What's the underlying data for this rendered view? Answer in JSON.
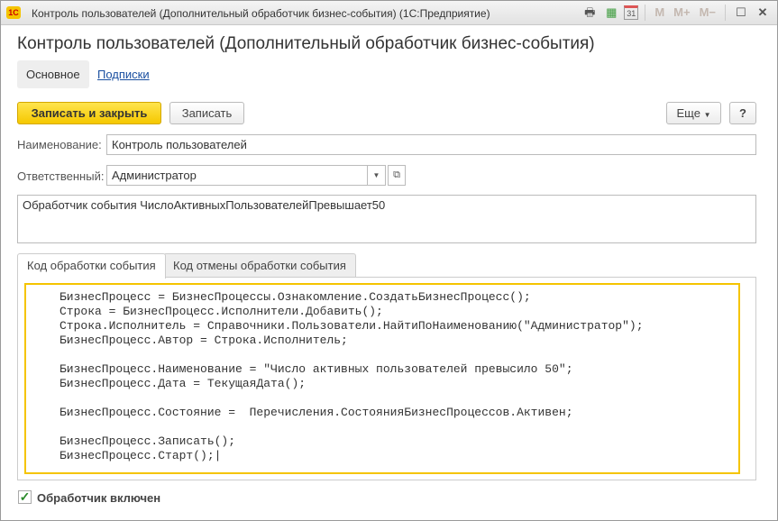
{
  "window": {
    "title": "Контроль пользователей (Дополнительный обработчик бизнес-события)  (1С:Предприятие)",
    "logo": "1С",
    "icons": [
      "print-icon",
      "calculator-icon",
      "calendar-icon"
    ],
    "calendar_day": "31",
    "mem": [
      "M",
      "M+",
      "M−"
    ]
  },
  "header": {
    "title": "Контроль пользователей (Дополнительный обработчик бизнес-события)"
  },
  "tabs_top": [
    {
      "label": "Основное"
    },
    {
      "label": "Подписки"
    }
  ],
  "toolbar": {
    "save_close": "Записать и закрыть",
    "save": "Записать",
    "more": "Еще",
    "help": "?"
  },
  "form": {
    "name_label": "Наименование:",
    "name_value": "Контроль пользователей",
    "resp_label": "Ответственный:",
    "resp_value": "Администратор",
    "description": "Обработчик события ЧислоАктивныхПользователейПревышает50"
  },
  "code_tabs": [
    {
      "label": "Код обработки события"
    },
    {
      "label": "Код отмены обработки события"
    }
  ],
  "code": "БизнесПроцесс = БизнесПроцессы.Ознакомление.СоздатьБизнесПроцесс();\nСтрока = БизнесПроцесс.Исполнители.Добавить();\nСтрока.Исполнитель = Справочники.Пользователи.НайтиПоНаименованию(\"Администратор\");\nБизнесПроцесс.Автор = Строка.Исполнитель;\n\nБизнесПроцесс.Наименование = \"Число активных пользователей превысило 50\";\nБизнесПроцесс.Дата = ТекущаяДата();\n\nБизнесПроцесс.Состояние =  Перечисления.СостоянияБизнесПроцессов.Активен;\n\nБизнесПроцесс.Записать();\nБизнесПроцесс.Старт();|",
  "enabled": {
    "label": "Обработчик включен",
    "checked": true
  },
  "colors": {
    "accent": "#f5c400",
    "link": "#1a4fa0"
  }
}
